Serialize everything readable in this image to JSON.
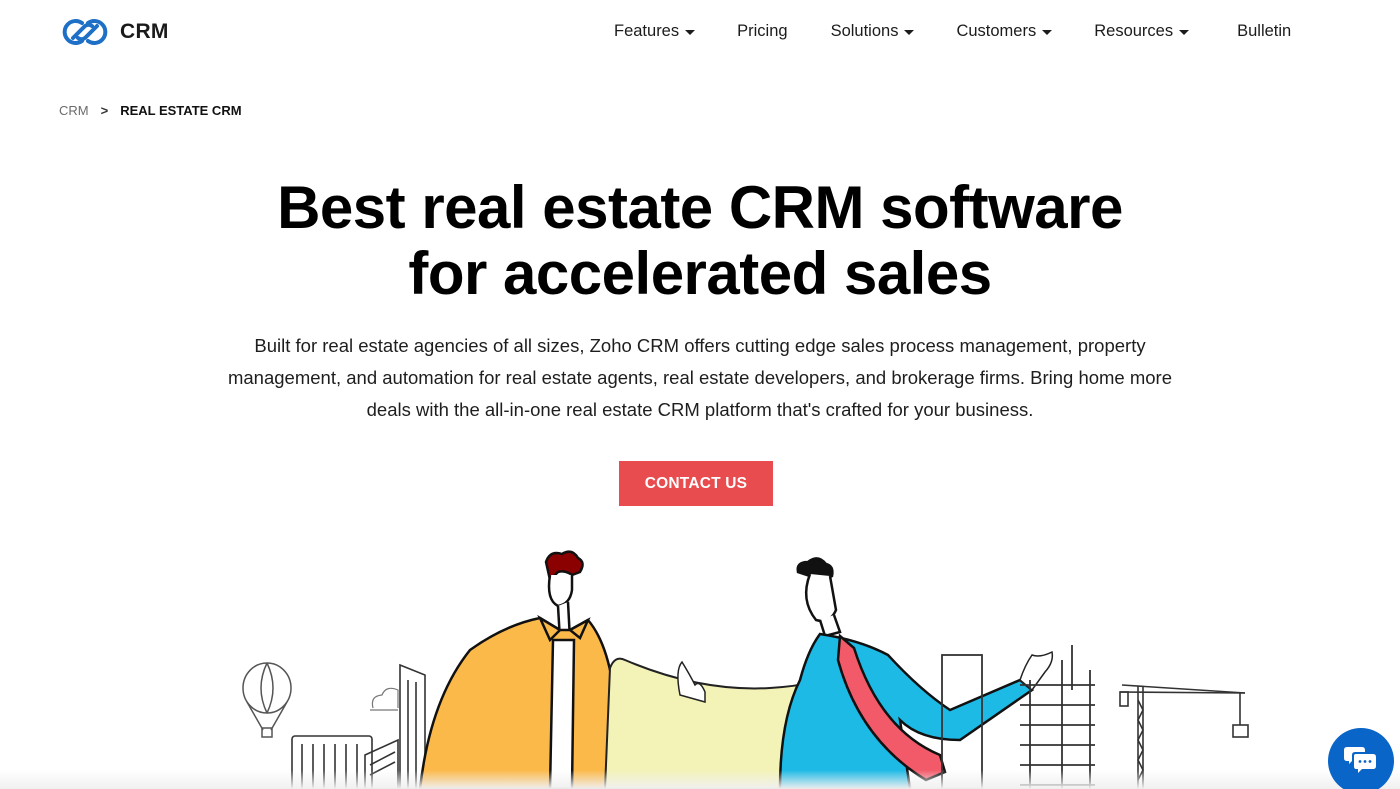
{
  "header": {
    "logo_text": "CRM",
    "brand_color": "#1e6fc6",
    "nav": [
      {
        "label": "Features",
        "has_dropdown": true
      },
      {
        "label": "Pricing",
        "has_dropdown": false
      },
      {
        "label": "Solutions",
        "has_dropdown": true
      },
      {
        "label": "Customers",
        "has_dropdown": true
      },
      {
        "label": "Resources",
        "has_dropdown": true
      },
      {
        "label": "Bulletin",
        "has_dropdown": false
      }
    ]
  },
  "breadcrumb": {
    "root": "CRM",
    "separator": ">",
    "current": "REAL ESTATE CRM"
  },
  "hero": {
    "title_line1": "Best real estate CRM software",
    "title_line2": "for accelerated sales",
    "description": "Built for real estate agencies of all sizes, Zoho CRM offers cutting edge sales process management, property management, and automation for real estate agents, real estate developers, and brokerage firms. Bring home more deals with the all-in-one real estate CRM platform that's crafted for your business.",
    "cta_label": "CONTACT US",
    "cta_color": "#e84c4e"
  },
  "illustration": {
    "description": "Two men holding a building blueprint with city skyline, hot air balloon and construction crane",
    "colors": {
      "jacket": "#fbb94a",
      "shirt": "#1ebae6",
      "tie": "#f25a6a",
      "paper": "#f3f3b8",
      "hair_left": "#8b0000"
    }
  },
  "chat": {
    "icon": "chat-bubbles-icon",
    "color": "#0a65c9"
  }
}
